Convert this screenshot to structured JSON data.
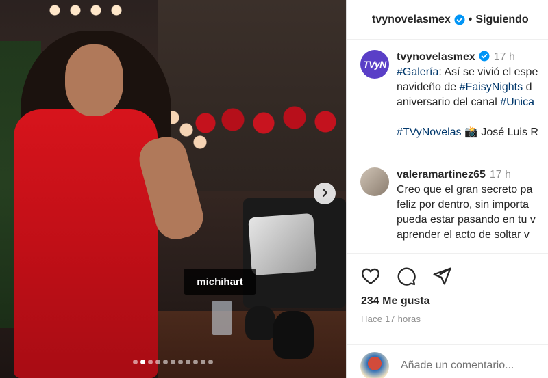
{
  "post_image": {
    "tagged_user": "michihart",
    "carousel_count": 11,
    "carousel_active_index": 1
  },
  "header": {
    "username": "tvynovelasmex",
    "separator": "•",
    "follow_label": "Siguiendo"
  },
  "caption": {
    "avatar_text": "TVyN",
    "username": "tvynovelasmex",
    "time": "17 h",
    "lines": [
      [
        {
          "text": "#Galería",
          "link": true
        },
        {
          "text": ": Así se vivió el espe",
          "link": false
        }
      ],
      [
        {
          "text": "navideño de ",
          "link": false
        },
        {
          "text": "#FaisyNights",
          "link": true
        },
        {
          "text": " d",
          "link": false
        }
      ],
      [
        {
          "text": "aniversario del canal ",
          "link": false
        },
        {
          "text": "#Unica",
          "link": true
        }
      ],
      [
        {
          "text": "",
          "link": false
        }
      ],
      [
        {
          "text": "#TVyNovelas",
          "link": true
        },
        {
          "text": " 📸 José Luis R",
          "link": false
        }
      ]
    ]
  },
  "comment": {
    "username": "valeramartinez65",
    "time": "17 h",
    "lines": [
      "Creo que el gran secreto pa",
      "feliz por dentro, sin importa",
      "pueda estar pasando en tu v",
      "aprender el acto de soltar v"
    ]
  },
  "actions": {
    "likes": "234 Me gusta",
    "posted": "Hace 17 horas"
  },
  "add_comment": {
    "placeholder": "Añade un comentario..."
  },
  "colors": {
    "verified": "#0095f6",
    "link": "#00376b",
    "muted": "#8e8e8e",
    "avatar_tvn": "#5a3fc7"
  },
  "icons": [
    "heart-icon",
    "comment-icon",
    "share-icon",
    "verified-badge-icon",
    "chevron-right-icon"
  ]
}
